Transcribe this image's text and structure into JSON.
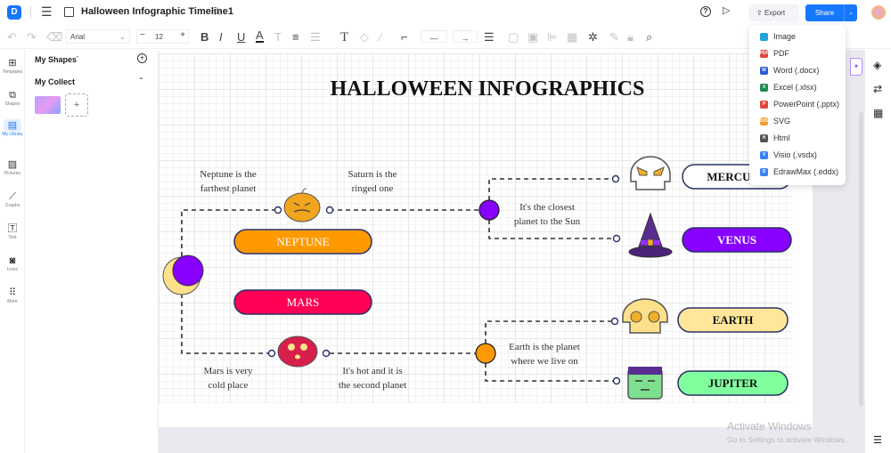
{
  "app": {
    "title": "Halloween Infographic Timeline1",
    "brand_color": "#1677ff"
  },
  "topbar": {
    "export_label": "Export",
    "share_label": "Share"
  },
  "toolbar": {
    "font": "Arial",
    "font_size": "12"
  },
  "rail": [
    {
      "label": "Templates",
      "icon": "templates-icon"
    },
    {
      "label": "Shapes",
      "icon": "shapes-icon"
    },
    {
      "label": "My Library",
      "icon": "library-icon"
    },
    {
      "label": "Pictures",
      "icon": "pictures-icon"
    },
    {
      "label": "Graphs",
      "icon": "graphs-icon"
    },
    {
      "label": "Text",
      "icon": "text-icon"
    },
    {
      "label": "Icons",
      "icon": "icons-icon"
    },
    {
      "label": "More",
      "icon": "more-icon"
    }
  ],
  "panel": {
    "my_shapes": "My Shapes",
    "my_collect": "My Collect"
  },
  "export_menu": [
    {
      "label": "Image",
      "color": "#1fa3d8",
      "badge": ""
    },
    {
      "label": "PDF",
      "color": "#e0463a",
      "badge": "PDF"
    },
    {
      "label": "Word (.docx)",
      "color": "#2a5bd7",
      "badge": "W"
    },
    {
      "label": "Excel (.xlsx)",
      "color": "#1e8a4c",
      "badge": "X"
    },
    {
      "label": "PowerPoint (.pptx)",
      "color": "#e0463a",
      "badge": "P"
    },
    {
      "label": "SVG",
      "color": "#f0a030",
      "badge": "SVG"
    },
    {
      "label": "Html",
      "color": "#555555",
      "badge": "H"
    },
    {
      "label": "Visio (.vsdx)",
      "color": "#3b82f6",
      "badge": "V"
    },
    {
      "label": "EdrawMax (.eddx)",
      "color": "#3b82f6",
      "badge": "D"
    }
  ],
  "diagram": {
    "title": "HALLOWEEN INFOGRAPHICS",
    "planets": [
      {
        "label": "NEPTUNE",
        "fill": "#ff9900",
        "text": "#ffffff"
      },
      {
        "label": "MARS",
        "fill": "#ff0055",
        "text": "#ffffff"
      },
      {
        "label": "MERCURY",
        "fill": "#ffffff",
        "text": "#111111"
      },
      {
        "label": "VENUS",
        "fill": "#8800ff",
        "text": "#ffffff"
      },
      {
        "label": "EARTH",
        "fill": "#ffe699",
        "text": "#111111"
      },
      {
        "label": "JUPITER",
        "fill": "#80ff9f",
        "text": "#111111"
      }
    ],
    "notes": {
      "neptune": [
        "Neptune is the",
        "farthest planet"
      ],
      "saturn": [
        "Saturn is the",
        "ringed one"
      ],
      "mercury": [
        "It's the closest",
        "planet to the Sun"
      ],
      "mars": [
        "Mars is very",
        "cold place"
      ],
      "venus": [
        "It's hot and it is",
        "the second planet"
      ],
      "earth": [
        "Earth is the planet",
        "where we live on"
      ]
    }
  },
  "watermark": {
    "line1": "Activate Windows",
    "line2": "Go to Settings to activate Windows."
  }
}
